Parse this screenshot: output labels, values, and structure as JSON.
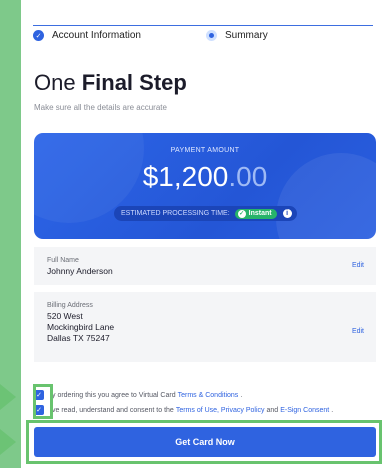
{
  "steps": [
    {
      "label": "Account Information"
    },
    {
      "label": "Summary"
    }
  ],
  "heading": {
    "light": "One ",
    "bold": "Final Step"
  },
  "subtitle": "Make sure all the details are accurate",
  "payment": {
    "label": "PAYMENT AMOUNT",
    "whole": "$1,200",
    "cents": ".00",
    "eta_label": "ESTIMATED PROCESSING TIME:",
    "eta_badge": "Instant"
  },
  "name_box": {
    "label": "Full Name",
    "value": "Johnny Anderson",
    "edit": "Edit"
  },
  "address_box": {
    "label": "Billing Address",
    "lines": [
      "520 West",
      "Mockingbird Lane",
      "Dallas  TX  75247"
    ],
    "edit": "Edit"
  },
  "agreements": [
    {
      "prefix": "y ordering this you agree to Virtual Card",
      "link1": "Terms & Conditions",
      "suffix": "."
    },
    {
      "prefix": "ve read, understand and consent to the",
      "link1": "Terms of Use, Privacy Policy",
      "mid": "and",
      "link2": "E-Sign Consent",
      "suffix": "."
    }
  ],
  "cta_label": "Get Card Now",
  "colors": {
    "accent": "#2f63e0",
    "highlight": "#68c36e",
    "background": "#7ec98a"
  }
}
